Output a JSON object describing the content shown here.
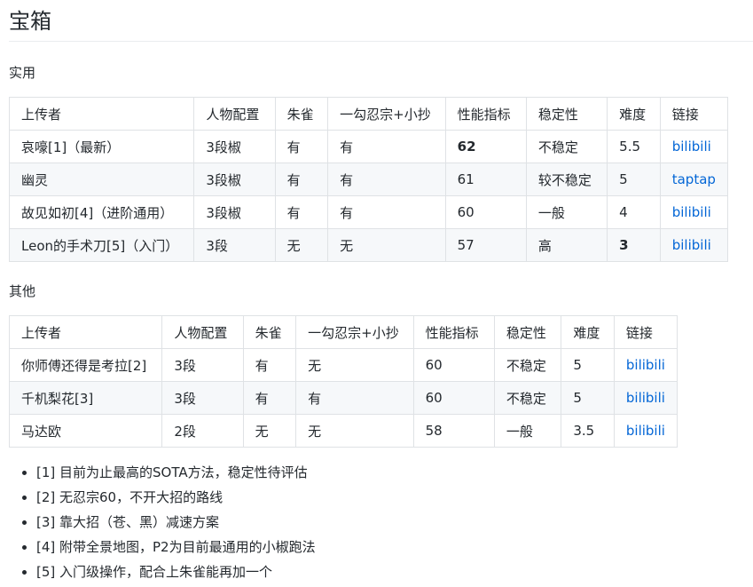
{
  "title": "宝箱",
  "sections": [
    {
      "label": "实用",
      "headers": [
        "上传者",
        "人物配置",
        "朱雀",
        "一勾忍宗+小抄",
        "性能指标",
        "稳定性",
        "难度",
        "链接"
      ],
      "rows": [
        [
          "哀嚎[1]（最新）",
          "3段椒",
          "有",
          "有",
          "62",
          "不稳定",
          "5.5",
          "bilibili"
        ],
        [
          "幽灵",
          "3段椒",
          "有",
          "有",
          "61",
          "较不稳定",
          "5",
          "taptap"
        ],
        [
          "故见如初[4]（进阶通用）",
          "3段椒",
          "有",
          "有",
          "60",
          "一般",
          "4",
          "bilibili"
        ],
        [
          "Leon的手术刀[5]（入门）",
          "3段",
          "无",
          "无",
          "57",
          "高",
          "3",
          "bilibili"
        ]
      ]
    },
    {
      "label": "其他",
      "headers": [
        "上传者",
        "人物配置",
        "朱雀",
        "一勾忍宗+小抄",
        "性能指标",
        "稳定性",
        "难度",
        "链接"
      ],
      "rows": [
        [
          "你师傅还得是考拉[2]",
          "3段",
          "有",
          "无",
          "60",
          "不稳定",
          "5",
          "bilibili"
        ],
        [
          "千机梨花[3]",
          "3段",
          "有",
          "有",
          "60",
          "不稳定",
          "5",
          "bilibili"
        ],
        [
          "马达欧",
          "2段",
          "无",
          "无",
          "58",
          "一般",
          "3.5",
          "bilibili"
        ]
      ]
    }
  ],
  "notes": [
    "[1] 目前为止最高的SOTA方法，稳定性待评估",
    "[2] 无忍宗60，不开大招的路线",
    "[3] 靠大招（苍、黑）减速方案",
    "[4] 附带全景地图，P2为目前最通用的小椒跑法",
    "[5] 入门级操作，配合上朱雀能再加一个"
  ],
  "colors": {
    "text": "#24292e",
    "link": "#0366d6",
    "border": "#dfe2e5",
    "stripe": "#f6f8fa"
  }
}
